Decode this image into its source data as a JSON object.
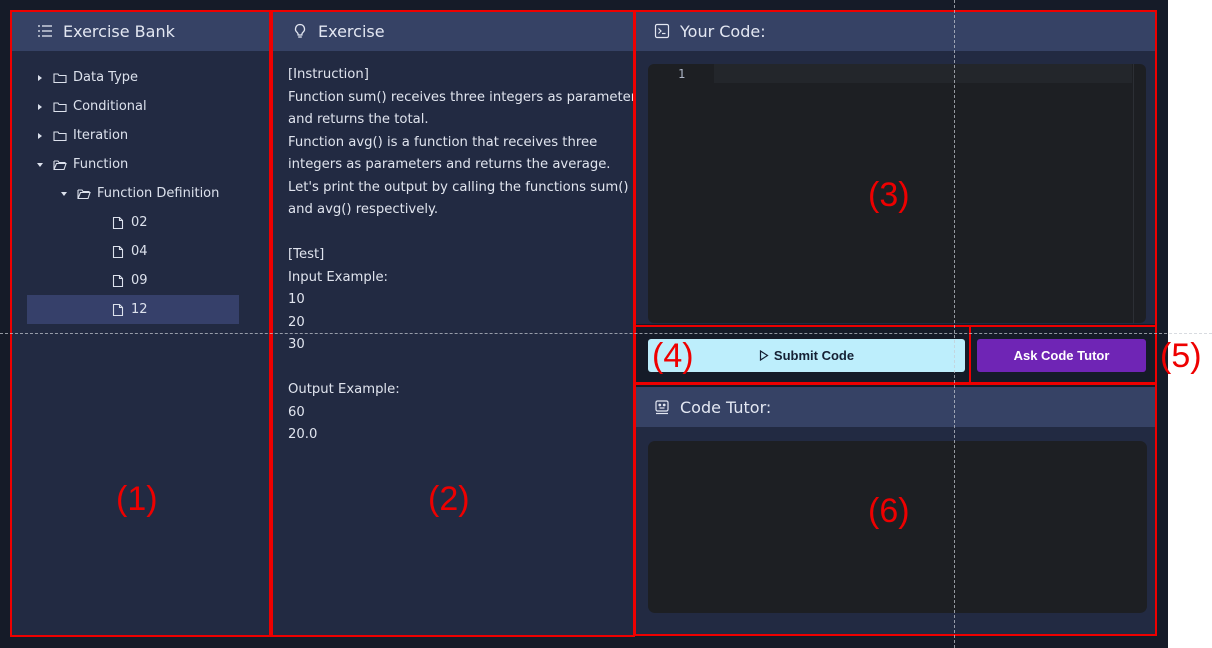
{
  "exercise_bank": {
    "title": "Exercise Bank",
    "icon": "list-icon",
    "tree": [
      {
        "label": "Data Type",
        "type": "folder",
        "expanded": false,
        "level": 0
      },
      {
        "label": "Conditional",
        "type": "folder",
        "expanded": false,
        "level": 0
      },
      {
        "label": "Iteration",
        "type": "folder",
        "expanded": false,
        "level": 0
      },
      {
        "label": "Function",
        "type": "folder",
        "expanded": true,
        "level": 0
      },
      {
        "label": "Function Definition",
        "type": "folder",
        "expanded": true,
        "level": 1
      },
      {
        "label": "02",
        "type": "file",
        "level": 2
      },
      {
        "label": "04",
        "type": "file",
        "level": 2
      },
      {
        "label": "09",
        "type": "file",
        "level": 2
      },
      {
        "label": "12",
        "type": "file",
        "level": 2,
        "selected": true
      }
    ]
  },
  "exercise": {
    "title": "Exercise",
    "icon": "lightbulb-icon",
    "lines": [
      "[Instruction]",
      "Function sum() receives three integers as parameters",
      "and returns the total.",
      "Function avg() is a function that receives three",
      "integers as parameters and returns the average.",
      "Let's print the output by calling the functions sum()",
      "and avg() respectively.",
      "",
      "[Test]",
      "Input Example:",
      "10",
      "20",
      "30",
      "",
      "Output Example:",
      "60",
      "20.0"
    ]
  },
  "code": {
    "title": "Your Code:",
    "icon": "terminal-icon",
    "line_number": "1"
  },
  "buttons": {
    "submit": "Submit Code",
    "tutor": "Ask Code Tutor"
  },
  "tutor": {
    "title": "Code Tutor:",
    "icon": "robot-icon"
  },
  "annotations": {
    "a1": "(1)",
    "a2": "(2)",
    "a3": "(3)",
    "a4": "(4)",
    "a5": "(5)",
    "a6": "(6)"
  },
  "colors": {
    "background": "#151b28",
    "panel": "#222a42",
    "header": "#364265",
    "submit": "#bdeefc",
    "tutor_button": "#6f25b5",
    "annotation": "#ee0000"
  }
}
